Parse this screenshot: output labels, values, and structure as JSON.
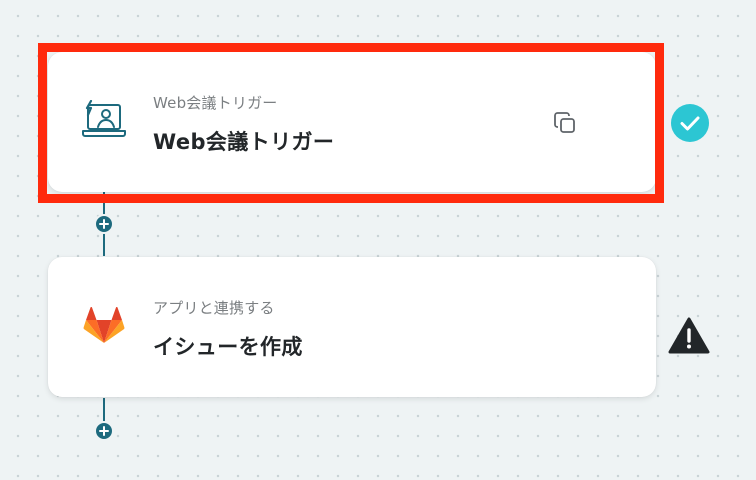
{
  "flow": {
    "steps": [
      {
        "app_label": "Web会議トリガー",
        "title": "Web会議トリガー",
        "icon": "web-meeting-icon",
        "status": "complete",
        "status_icon": "check-circle-icon",
        "selected": true
      },
      {
        "app_label": "アプリと連携する",
        "title": "イシューを作成",
        "icon": "gitlab-icon",
        "status": "warning",
        "status_icon": "warning-triangle-icon",
        "selected": false
      }
    ]
  },
  "colors": {
    "connector": "#1d6a7e",
    "highlight": "#ff2a0d",
    "success": "#2cc6d3",
    "warning": "#222629",
    "gitlab_orange": "#e24329"
  }
}
